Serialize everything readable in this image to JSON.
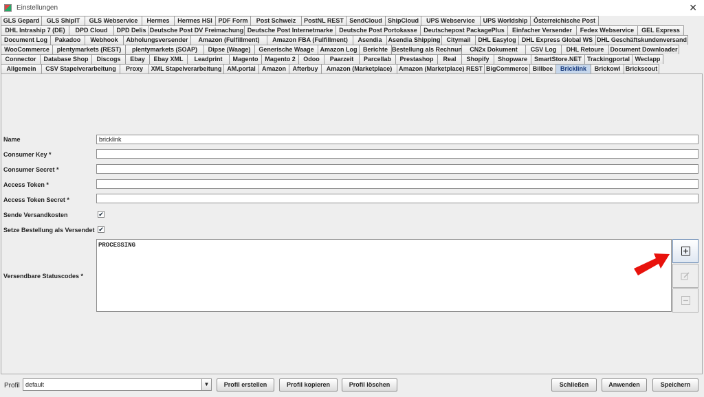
{
  "window": {
    "title": "Einstellungen",
    "close_glyph": "✕"
  },
  "tabs": {
    "rows": [
      [
        "GLS Gepard",
        "GLS ShipIT",
        "GLS Webservice",
        "Hermes",
        "Hermes HSI",
        "PDF Form",
        "Post Schweiz",
        "PostNL REST",
        "SendCloud",
        "ShipCloud",
        "UPS Webservice",
        "UPS Worldship",
        "Österreichische Post"
      ],
      [
        "DHL Intraship 7 (DE)",
        "DPD Cloud",
        "DPD Delis",
        "Deutsche Post DV Freimachung",
        "Deutsche Post Internetmarke",
        "Deutsche Post Portokasse",
        "Deutschepost PackagePlus",
        "Einfacher Versender",
        "Fedex Webservice",
        "GEL Express"
      ],
      [
        "Document Log",
        "Pakadoo",
        "Webhook",
        "Abholungsversender",
        "Amazon (Fulfillment)",
        "Amazon FBA (Fulfillment)",
        "Asendia",
        "Asendia Shipping",
        "Citymail",
        "DHL Easylog",
        "DHL Express Global WS",
        "DHL Geschäftskundenversand"
      ],
      [
        "WooCommerce",
        "plentymarkets (REST)",
        "plentymarkets (SOAP)",
        "Dipse (Waage)",
        "Generische Waage",
        "Amazon Log",
        "Berichte",
        "Bestellung als Rechnung",
        "CN2x Dokument",
        "CSV Log",
        "DHL Retoure",
        "Document Downloader"
      ],
      [
        "Connector",
        "Database Shop",
        "Discogs",
        "Ebay",
        "Ebay XML",
        "Leadprint",
        "Magento",
        "Magento 2",
        "Odoo",
        "Paarzeit",
        "Parcellab",
        "Prestashop",
        "Real",
        "Shopify",
        "Shopware",
        "SmartStore.NET",
        "Trackingportal",
        "Weclapp"
      ],
      [
        "Allgemein",
        "CSV Stapelverarbeitung",
        "Proxy",
        "XML Stapelverarbeitung",
        "AM.portal",
        "Amazon",
        "Afterbuy",
        "Amazon (Marketplace)",
        "Amazon (Marketplace) REST",
        "BigCommerce",
        "Billbee",
        "Bricklink",
        "Brickowl",
        "Brickscout"
      ]
    ],
    "active": "Bricklink"
  },
  "form": {
    "name_label": "Name",
    "name_value": "bricklink",
    "consumer_key_label": "Consumer Key *",
    "consumer_key_value": "",
    "consumer_secret_label": "Consumer Secret *",
    "consumer_secret_value": "",
    "access_token_label": "Access Token *",
    "access_token_value": "",
    "access_token_secret_label": "Access Token Secret *",
    "access_token_secret_value": "",
    "send_shipping_label": "Sende Versandkosten",
    "send_shipping_checked": true,
    "set_order_shipped_label": "Setze Bestellung als Versendet",
    "set_order_shipped_checked": true,
    "status_codes_label": "Versendbare Statuscodes *",
    "status_codes_list": [
      "PROCESSING"
    ],
    "check_glyph": "✔"
  },
  "side_buttons": {
    "add_icon": "plus-square-icon",
    "edit_icon": "edit-icon",
    "remove_icon": "minus-square-icon"
  },
  "annotation": {
    "arrow_color": "#e8120c"
  },
  "footer": {
    "profil_label": "Profil",
    "profil_value": "default",
    "combo_arrow": "▼",
    "create_label": "Profil erstellen",
    "copy_label": "Profil kopieren",
    "delete_label": "Profil löschen",
    "close_label": "Schließen",
    "apply_label": "Anwenden",
    "save_label": "Speichern"
  }
}
